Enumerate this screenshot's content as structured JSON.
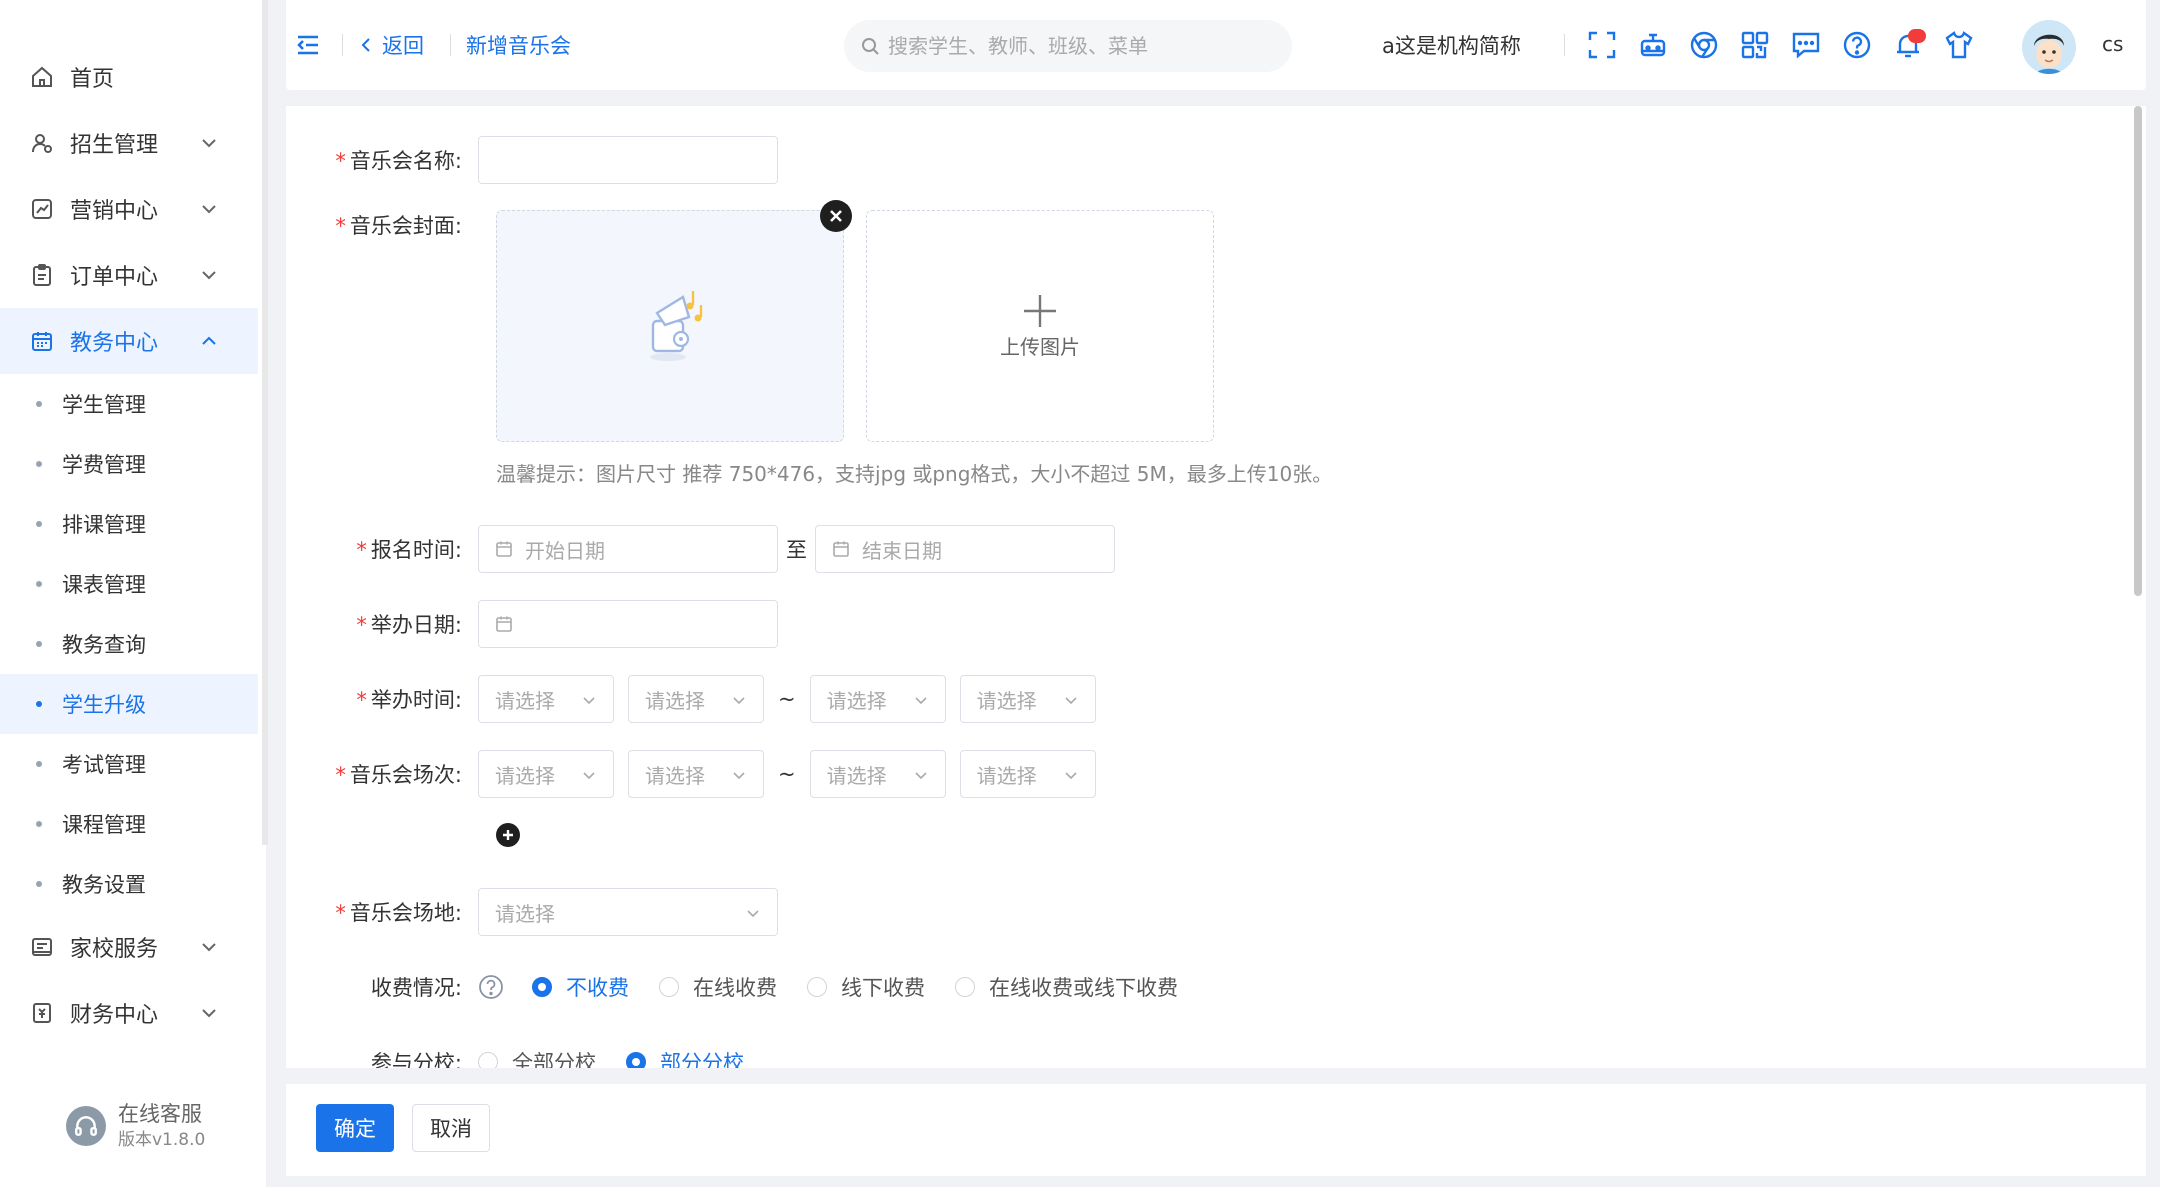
{
  "sidebar": {
    "menu": [
      {
        "label": "首页",
        "icon": "home-icon",
        "expandable": false
      },
      {
        "label": "招生管理",
        "icon": "user-admission-icon",
        "expandable": true
      },
      {
        "label": "营销中心",
        "icon": "marketing-chart-icon",
        "expandable": true
      },
      {
        "label": "订单中心",
        "icon": "clipboard-icon",
        "expandable": true
      },
      {
        "label": "教务中心",
        "icon": "calendar-icon",
        "expandable": true,
        "active": true
      }
    ],
    "submenu": [
      {
        "label": "学生管理"
      },
      {
        "label": "学费管理"
      },
      {
        "label": "排课管理"
      },
      {
        "label": "课表管理"
      },
      {
        "label": "教务查询"
      },
      {
        "label": "学生升级",
        "active": true
      },
      {
        "label": "考试管理"
      },
      {
        "label": "课程管理"
      },
      {
        "label": "教务设置"
      }
    ],
    "menu_after": [
      {
        "label": "家校服务",
        "icon": "home-school-icon"
      },
      {
        "label": "财务中心",
        "icon": "finance-icon"
      }
    ],
    "support": {
      "label": "在线客服",
      "version": "版本v1.8.0"
    }
  },
  "header": {
    "back_label": "返回",
    "crumb": "新增音乐会",
    "search_placeholder": "搜索学生、教师、班级、菜单",
    "org_name": "a这是机构简称",
    "icons": [
      "fullscreen-icon",
      "robot-icon",
      "chrome-icon",
      "qrcode-icon",
      "message-icon",
      "help-icon",
      "bell-icon",
      "shirt-icon"
    ],
    "username": "cs"
  },
  "form": {
    "name": {
      "label": "音乐会名称:",
      "value": ""
    },
    "cover": {
      "label": "音乐会封面:",
      "upload_label": "上传图片"
    },
    "hint": "温馨提示：图片尺寸 推荐 750*476，支持jpg 或png格式，大小不超过 5M，最多上传10张。",
    "signup": {
      "label": "报名时间:",
      "start_placeholder": "开始日期",
      "to": "至",
      "end_placeholder": "结束日期"
    },
    "hold_date": {
      "label": "举办日期:",
      "value": ""
    },
    "hold_time": {
      "label": "举办时间:",
      "placeholders": [
        "请选择",
        "请选择",
        "请选择",
        "请选择"
      ],
      "tilde": "~"
    },
    "sessions": {
      "label": "音乐会场次:",
      "placeholders": [
        "请选择",
        "请选择",
        "请选择",
        "请选择"
      ],
      "tilde": "~"
    },
    "venue": {
      "label": "音乐会场地:",
      "placeholder": "请选择"
    },
    "fee": {
      "label": "收费情况:",
      "options": [
        "不收费",
        "在线收费",
        "线下收费",
        "在线收费或线下收费"
      ],
      "selected": "不收费"
    },
    "branch": {
      "label": "参与分校:",
      "options": [
        "全部分校",
        "部分分校"
      ],
      "selected": "部分分校"
    }
  },
  "footer": {
    "confirm_label": "确定",
    "cancel_label": "取消"
  },
  "colors": {
    "primary": "#1a73e8",
    "required": "#f23c3c"
  }
}
